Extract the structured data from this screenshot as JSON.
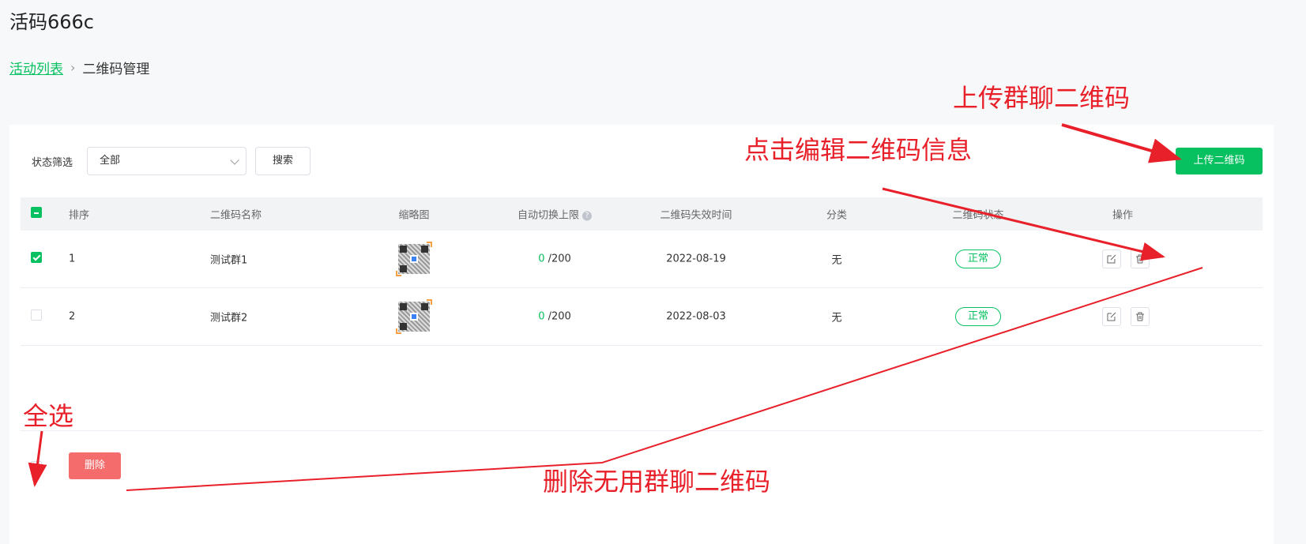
{
  "app": {
    "title": "活码666c"
  },
  "breadcrumb": {
    "parent": "活动列表",
    "current": "二维码管理"
  },
  "filter": {
    "label": "状态筛选",
    "selected": "全部",
    "search_label": "搜索",
    "upload_label": "上传二维码"
  },
  "table": {
    "headers": {
      "order": "排序",
      "name": "二维码名称",
      "thumbnail": "缩略图",
      "limit": "自动切换上限",
      "expire": "二维码失效时间",
      "category": "分类",
      "status": "二维码状态",
      "ops": "操作"
    },
    "rows": [
      {
        "order": "1",
        "name": "测试群1",
        "count": "0",
        "limit": " /200",
        "expire": "2022-08-19",
        "category": "无",
        "status": "正常",
        "checked": true
      },
      {
        "order": "2",
        "name": "测试群2",
        "count": "0",
        "limit": " /200",
        "expire": "2022-08-03",
        "category": "无",
        "status": "正常",
        "checked": false
      }
    ]
  },
  "footer": {
    "delete_label": "删除"
  },
  "annotations": {
    "upload": "上传群聊二维码",
    "edit": "点击编辑二维码信息",
    "select_all": "全选",
    "delete": "删除无用群聊二维码"
  },
  "colors": {
    "accent": "#07c160",
    "danger": "#f56c6c",
    "annotation": "#e8202a"
  }
}
